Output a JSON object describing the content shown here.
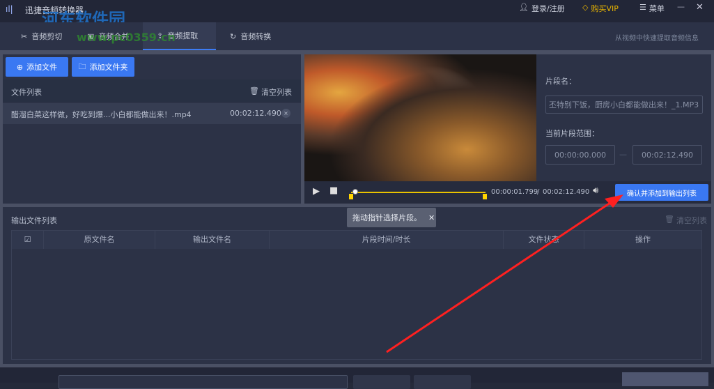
{
  "app": {
    "title": "迅捷音频转换器",
    "watermark": "河东软件园",
    "watermark_url": "www.pc0359.cn"
  },
  "header": {
    "login": "登录/注册",
    "vip": "购买VIP",
    "menu": "菜单",
    "minimize": "—",
    "close": "✕"
  },
  "tabs": [
    {
      "label": "音频剪切"
    },
    {
      "label": "音频合并"
    },
    {
      "label": "音频提取"
    },
    {
      "label": "音频转换"
    }
  ],
  "tab_hint": "从视频中快速提取音频信息",
  "left": {
    "add_file": "添加文件",
    "add_folder": "添加文件夹",
    "list_title": "文件列表",
    "clear": "清空列表",
    "files": [
      {
        "name": "醋溜白菜这样做，好吃到爆...小白都能做出来！.mp4",
        "duration": "00:02:12.490"
      }
    ]
  },
  "player": {
    "current": "00:00:01.799",
    "sep": "/",
    "total": "00:02:12.490",
    "progress": 0.014,
    "tooltip": "拖动指针选择片段。"
  },
  "segment": {
    "name_label": "片段名：",
    "name_value": "丕特别下饭，厨房小白都能做出来！_1.MP3",
    "range_label": "当前片段范围：",
    "start": "00:00:00.000",
    "dash": "—",
    "end": "00:02:12.490",
    "confirm": "确认并添加到输出列表"
  },
  "output": {
    "title": "输出文件列表",
    "clear": "清空列表",
    "columns": [
      "原文件名",
      "输出文件名",
      "片段时间/时长",
      "文件状态",
      "操作"
    ]
  },
  "colors": {
    "accent": "#3a78f2",
    "vip": "#e8b400",
    "arrow": "#ff2020"
  }
}
